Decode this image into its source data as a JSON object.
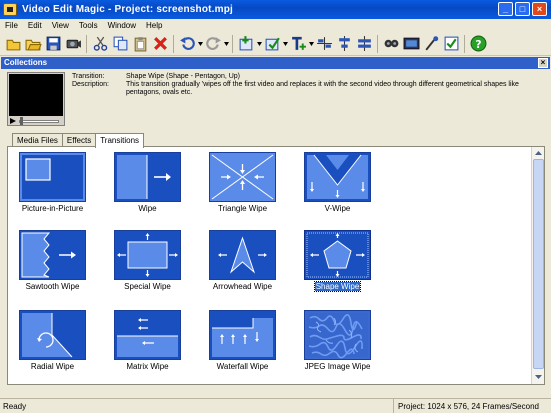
{
  "window": {
    "title": "Video Edit Magic - Project: screenshot.mpj"
  },
  "menu": [
    "File",
    "Edit",
    "View",
    "Tools",
    "Window",
    "Help"
  ],
  "toolbar_icons": [
    "new-project-icon",
    "open-project-icon",
    "save-icon",
    "capture-icon",
    "cut-icon",
    "copy-icon",
    "paste-icon",
    "delete-icon",
    "undo-icon",
    "redo-icon",
    "add-clip-icon",
    "edit-clip-icon",
    "add-text-icon",
    "align-left-icon",
    "align-center-icon",
    "split-icon",
    "record-icon",
    "preview-icon",
    "voice-icon",
    "check-icon",
    "help-icon"
  ],
  "panel": {
    "title": "Collections",
    "transition_label": "Transition:",
    "transition_value": "Shape Wipe (Shape - Pentagon, Up)",
    "description_label": "Description:",
    "description_value": "This transition gradually 'wipes off the first video and replaces it with the second video through different geometrical shapes like pentagons, ovals etc."
  },
  "tabs": [
    "Media Files",
    "Effects",
    "Transitions"
  ],
  "active_tab": "Transitions",
  "transitions": [
    {
      "name": "Picture-in-Picture",
      "icon": "picture-in-picture-icon"
    },
    {
      "name": "Wipe",
      "icon": "wipe-icon"
    },
    {
      "name": "Triangle Wipe",
      "icon": "triangle-wipe-icon"
    },
    {
      "name": "V-Wipe",
      "icon": "v-wipe-icon"
    },
    {
      "name": "Sawtooth Wipe",
      "icon": "sawtooth-wipe-icon"
    },
    {
      "name": "Special Wipe",
      "icon": "special-wipe-icon"
    },
    {
      "name": "Arrowhead Wipe",
      "icon": "arrowhead-wipe-icon"
    },
    {
      "name": "Shape Wipe",
      "icon": "shape-wipe-icon",
      "selected": true
    },
    {
      "name": "Radial Wipe",
      "icon": "radial-wipe-icon"
    },
    {
      "name": "Matrix Wipe",
      "icon": "matrix-wipe-icon"
    },
    {
      "name": "Waterfall Wipe",
      "icon": "waterfall-wipe-icon"
    },
    {
      "name": "JPEG Image Wipe",
      "icon": "jpeg-image-wipe-icon"
    }
  ],
  "status": {
    "left": "Ready",
    "right": "Project: 1024 x 576, 24 Frames/Second"
  },
  "colors": {
    "titlebar": "#0a5be0",
    "panel_header": "#2f5fc8",
    "tile_dark": "#1a4fc0",
    "tile_light": "#5b8be8",
    "selection": "#316ac5"
  }
}
